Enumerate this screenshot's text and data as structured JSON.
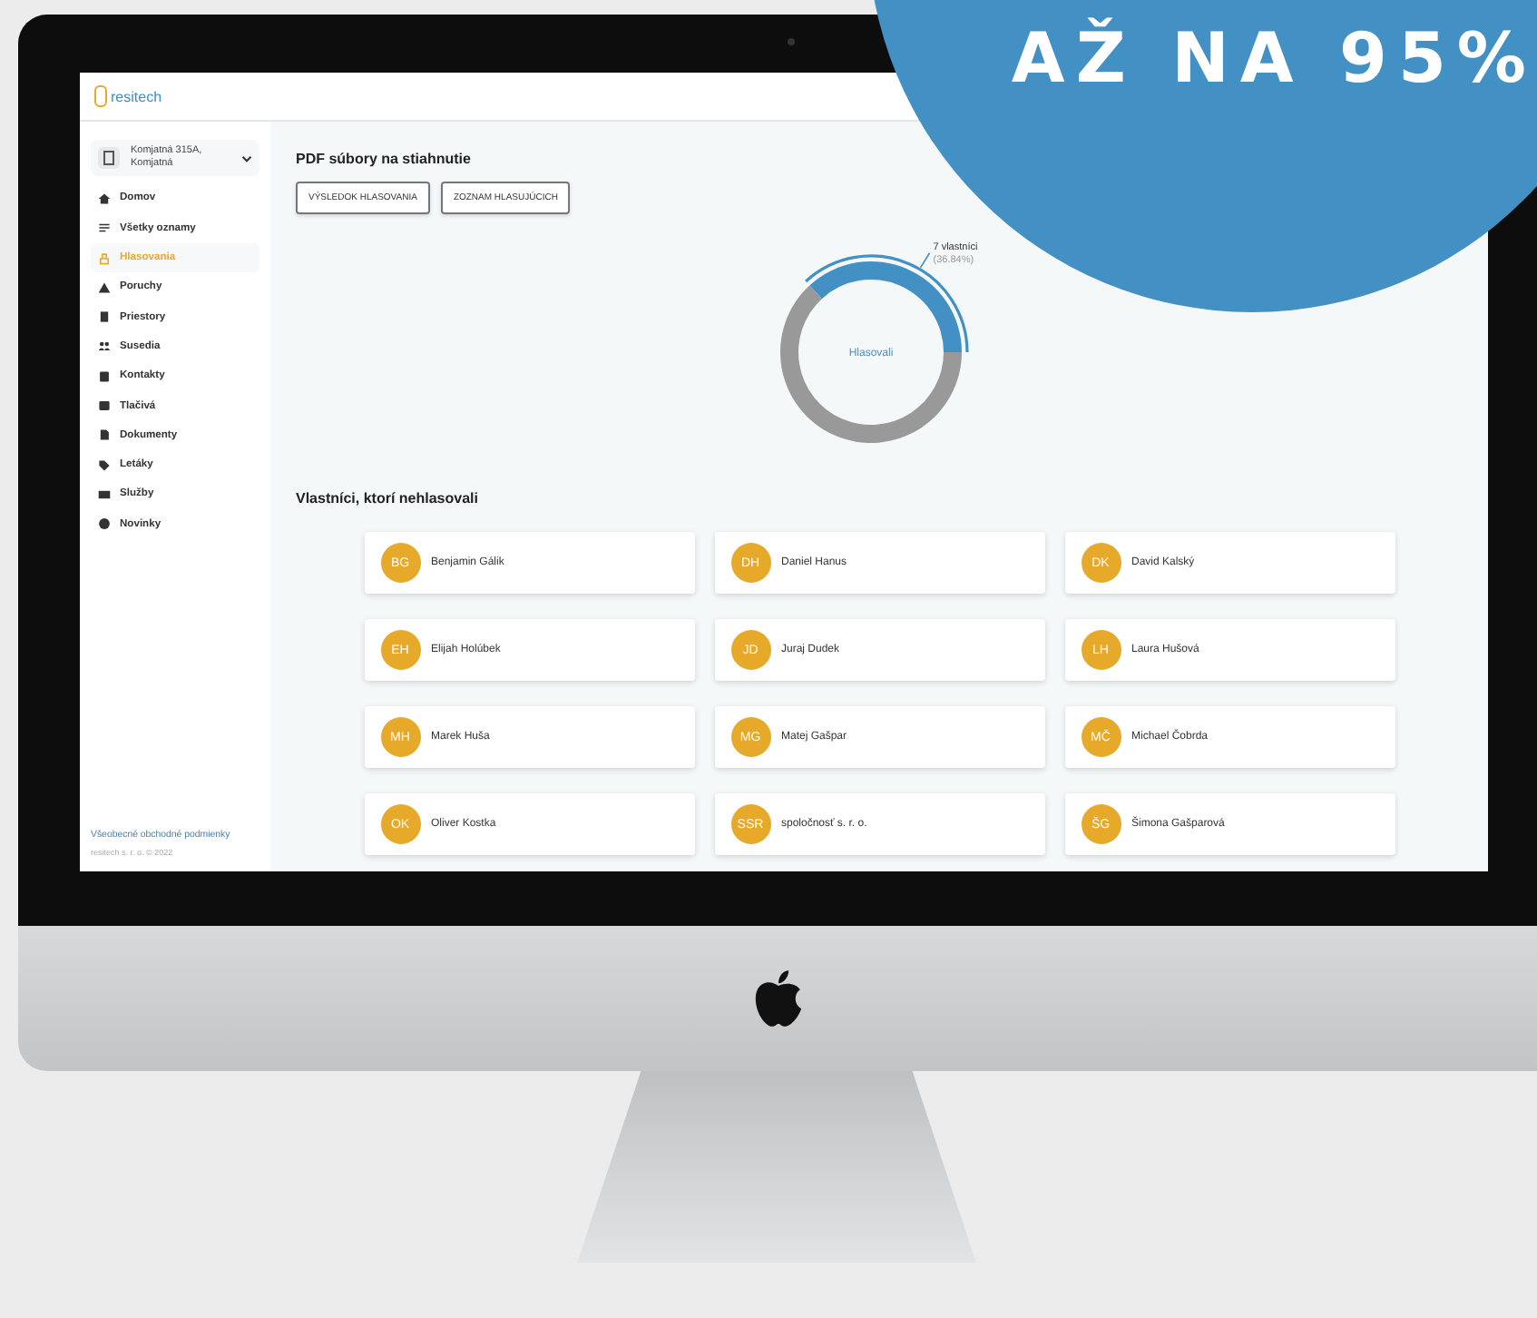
{
  "banner": {
    "text": "AŽ NA 95%"
  },
  "app": {
    "logo_text": "resitech"
  },
  "sidebar": {
    "building": {
      "line_1": "Komjatná 315A,",
      "line_2": "Komjatná"
    },
    "items": [
      {
        "label": "Domov",
        "selected": false
      },
      {
        "label": "Všetky oznamy",
        "selected": false
      },
      {
        "label": "Hlasovania",
        "selected": true
      },
      {
        "label": "Poruchy",
        "selected": false
      },
      {
        "label": "Priestory",
        "selected": false
      },
      {
        "label": "Susedia",
        "selected": false
      },
      {
        "label": "Kontakty",
        "selected": false
      },
      {
        "label": "Tlačivá",
        "selected": false
      },
      {
        "label": "Dokumenty",
        "selected": false
      },
      {
        "label": "Letáky",
        "selected": false
      },
      {
        "label": "Služby",
        "selected": false
      },
      {
        "label": "Novinky",
        "selected": false
      }
    ],
    "footer_link": "Všeobecné obchodné podmienky",
    "copyright": "resitech s. r. o. © 2022"
  },
  "downloads": {
    "title": "PDF súbory na stiahnutie",
    "buttons": [
      "VÝSLEDOK HLASOVANIA",
      "ZOZNAM HLASUJÚCICH"
    ]
  },
  "chart": {
    "center_label": "Hlasovali",
    "callout_count": "7 vlastníci",
    "callout_share": "(36.84%)",
    "chart_data": {
      "type": "donut",
      "values": [
        36.84,
        63.16
      ]
    }
  },
  "non_voters": {
    "title": "Vlastníci, ktorí nehlasovali",
    "owners": [
      {
        "initials": "BG",
        "name": "Benjamin Gálik"
      },
      {
        "initials": "DH",
        "name": "Daniel Hanus"
      },
      {
        "initials": "DK",
        "name": "David Kalský"
      },
      {
        "initials": "EH",
        "name": "Elijah Holúbek"
      },
      {
        "initials": "JD",
        "name": "Juraj Dudek"
      },
      {
        "initials": "LH",
        "name": "Laura Hušová"
      },
      {
        "initials": "MH",
        "name": "Marek Huša"
      },
      {
        "initials": "MG",
        "name": "Matej Gašpar"
      },
      {
        "initials": "MČ",
        "name": "Michael Čobrda"
      },
      {
        "initials": "OK",
        "name": "Oliver Kostka"
      },
      {
        "initials": "SSR",
        "name": "spoločnosť s. r. o."
      },
      {
        "initials": "ŠG",
        "name": "Šimona Gašparová"
      }
    ]
  }
}
